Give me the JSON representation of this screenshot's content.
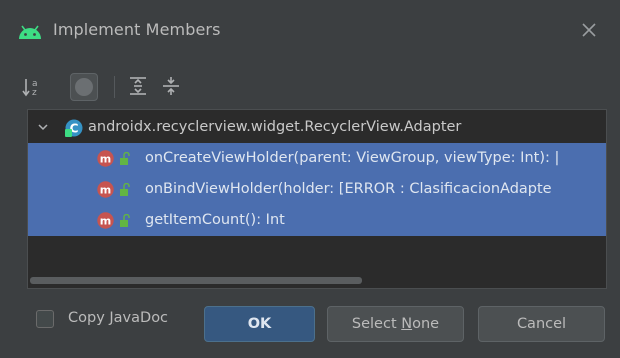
{
  "dialog": {
    "title": "Implement Members",
    "close_icon": "close-icon",
    "app_icon": "android-icon"
  },
  "toolbar": {
    "sort_icon": "sort-alphabetically-icon",
    "toggle_icon": "show-fields-toggle-icon",
    "expand_icon": "expand-all-icon",
    "collapse_icon": "collapse-all-icon"
  },
  "tree": {
    "root": {
      "label": "androidx.recyclerview.widget.RecyclerView.Adapter",
      "expanded": true,
      "icon_letter": "C"
    },
    "members": [
      {
        "label": "onCreateViewHolder(parent: ViewGroup, viewType: Int): |",
        "selected": true,
        "icon_letter": "m"
      },
      {
        "label": "onBindViewHolder(holder: [ERROR : ClasificacionAdapte",
        "selected": true,
        "icon_letter": "m"
      },
      {
        "label": "getItemCount(): Int",
        "selected": true,
        "icon_letter": "m"
      }
    ]
  },
  "footer": {
    "copy_javadoc": {
      "label_pre": "Copy ",
      "label_mnemonic": "J",
      "label_post": "avaDoc",
      "checked": false
    },
    "ok_label": "OK",
    "select_none": {
      "label_pre": "Select ",
      "label_mnemonic": "N",
      "label_post": "one"
    },
    "cancel_label": "Cancel"
  },
  "colors": {
    "background": "#3c3f41",
    "tree_background": "#2b2b2b",
    "selection": "#4b6eaf",
    "primary_button": "#365880",
    "android_green": "#3ddc84",
    "method_icon": "#c75450"
  }
}
